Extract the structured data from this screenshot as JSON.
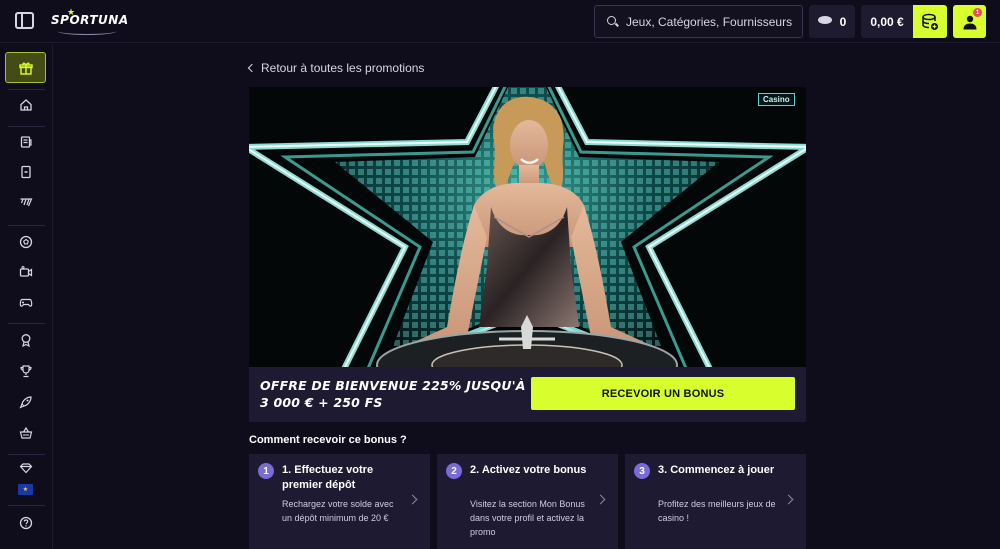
{
  "header": {
    "logo_text": "SPORTUNA",
    "search_placeholder": "Jeux, Catégories, Fournisseurs",
    "coins_count": "0",
    "balance": "0,00 €",
    "notification_count": "1"
  },
  "sidebar": {
    "items": [
      {
        "icon": "gift-icon",
        "active": true
      },
      {
        "icon": "home-icon"
      },
      {
        "icon": "sports-coupon-icon"
      },
      {
        "icon": "live-card-icon"
      },
      {
        "icon": "esports-icon"
      },
      {
        "icon": "football-icon"
      },
      {
        "icon": "video-camera-icon"
      },
      {
        "icon": "gamepad-icon"
      },
      {
        "icon": "award-icon"
      },
      {
        "icon": "trophy-icon"
      },
      {
        "icon": "rocket-icon"
      },
      {
        "icon": "shop-basket-icon"
      },
      {
        "icon": "diamond-icon"
      },
      {
        "icon": "language-flag-icon"
      },
      {
        "icon": "help-icon"
      }
    ],
    "flag_glyph": "★"
  },
  "promo": {
    "back_label": "Retour à toutes les promotions",
    "tag": "Casino",
    "title": "OFFRE DE BIENVENUE 225% JUSQU'À 3 000 € + 250 FS",
    "cta_label": "RECEVOIR UN BONUS",
    "how_title": "Comment recevoir ce bonus ?"
  },
  "steps": [
    {
      "number": "1",
      "title": "1. Effectuez votre premier dépôt",
      "description": "Rechargez votre solde avec un dépôt minimum de 20 €"
    },
    {
      "number": "2",
      "title": "2. Activez votre bonus",
      "description": "Visitez la section Mon Bonus dans votre profil et activez la promo"
    },
    {
      "number": "3",
      "title": "3. Commencez à jouer",
      "description": "Profitez des meilleurs jeux de casino !"
    }
  ],
  "colors": {
    "accent": "#d8ff2d",
    "background": "#0f0c1c",
    "card": "#1e1a31",
    "step_badge": "#7b6bd9"
  }
}
